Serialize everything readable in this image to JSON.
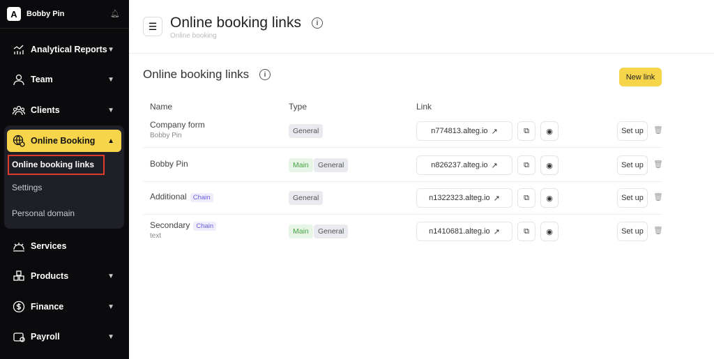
{
  "sidebar": {
    "account": "Bobby Pin",
    "logo": "A",
    "items": [
      {
        "label": "Analytical Reports"
      },
      {
        "label": "Team"
      },
      {
        "label": "Clients"
      },
      {
        "label": "Online Booking"
      },
      {
        "label": "Services"
      },
      {
        "label": "Products"
      },
      {
        "label": "Finance"
      },
      {
        "label": "Payroll"
      }
    ],
    "subitems": [
      {
        "label": "Online booking links"
      },
      {
        "label": "Settings"
      },
      {
        "label": "Personal domain"
      }
    ]
  },
  "header": {
    "title": "Online booking links",
    "breadcrumb": "Online booking"
  },
  "section": {
    "title": "Online booking links",
    "new_link": "New link"
  },
  "table": {
    "columns": [
      "Name",
      "Type",
      "Link"
    ],
    "rows": [
      {
        "name": "Company form",
        "sub": "Bobby Pin",
        "chain": null,
        "main": null,
        "general": "General",
        "link": "n774813.alteg.io",
        "setup": "Set up"
      },
      {
        "name": "Bobby Pin",
        "sub": null,
        "chain": null,
        "main": "Main",
        "general": "General",
        "link": "n826237.alteg.io",
        "setup": "Set up"
      },
      {
        "name": "Additional",
        "sub": null,
        "chain": "Chain",
        "main": null,
        "general": "General",
        "link": "n1322323.alteg.io",
        "setup": "Set up"
      },
      {
        "name": "Secondary",
        "sub": "text",
        "chain": "Chain",
        "main": "Main",
        "general": "General",
        "link": "n1410681.alteg.io",
        "setup": "Set up"
      }
    ]
  },
  "colors": {
    "accent": "#f7d54a",
    "sidebar": "#0b0b0e",
    "highlight": "#e03c2c"
  }
}
